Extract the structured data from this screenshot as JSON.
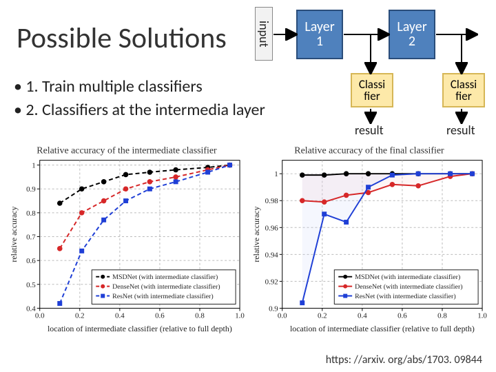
{
  "title": "Possible Solutions",
  "bullets": [
    "• 1. Train multiple classifiers",
    "• 2. Classifiers at the intermedia layer"
  ],
  "net": {
    "input": "input",
    "layer1": "Layer\n1",
    "layer2": "Layer\n2",
    "classi": "Classi\nfier",
    "result": "result"
  },
  "cite": "https: //arxiv. org/abs/1703. 09844",
  "chart_data": [
    {
      "type": "line",
      "title": "Relative accuracy of the intermediate classifier",
      "xlabel": "location of intermediate classifier (relative to full depth)",
      "ylabel": "relative accuracy",
      "xlim": [
        0.0,
        1.0
      ],
      "ylim": [
        0.4,
        1.02
      ],
      "xticks": [
        0.0,
        0.2,
        0.4,
        0.6,
        0.8,
        1.0
      ],
      "yticks": [
        0.4,
        0.5,
        0.6,
        0.7,
        0.8,
        0.9,
        1.0
      ],
      "grid": true,
      "styles": {
        "MSDNet (with intermediate classifier)": {
          "color": "#000000",
          "dashed": true,
          "marker": "circle"
        },
        "DenseNet (with intermediate classifier)": {
          "color": "#d62728",
          "dashed": true,
          "marker": "circle"
        },
        "ResNet (with intermediate classifier)": {
          "color": "#1f3fd6",
          "dashed": true,
          "marker": "square"
        }
      },
      "series": [
        {
          "name": "MSDNet (with intermediate classifier)",
          "x": [
            0.1,
            0.21,
            0.32,
            0.43,
            0.55,
            0.68,
            0.84,
            0.95
          ],
          "y": [
            0.84,
            0.9,
            0.93,
            0.96,
            0.97,
            0.98,
            0.99,
            1.0
          ]
        },
        {
          "name": "DenseNet (with intermediate classifier)",
          "x": [
            0.1,
            0.21,
            0.32,
            0.43,
            0.55,
            0.68,
            0.84,
            0.95
          ],
          "y": [
            0.65,
            0.8,
            0.85,
            0.9,
            0.93,
            0.95,
            0.98,
            1.0
          ]
        },
        {
          "name": "ResNet (with intermediate classifier)",
          "x": [
            0.1,
            0.21,
            0.32,
            0.43,
            0.55,
            0.68,
            0.84,
            0.95
          ],
          "y": [
            0.42,
            0.64,
            0.77,
            0.85,
            0.9,
            0.93,
            0.97,
            1.0
          ]
        }
      ],
      "legend_pos": "lower-right"
    },
    {
      "type": "line",
      "title": "Relative accuracy of the final classifier",
      "xlabel": "location of intermediate classifier (relative to full depth)",
      "ylabel": "relative accuracy",
      "xlim": [
        0.0,
        1.0
      ],
      "ylim": [
        0.9,
        1.01
      ],
      "xticks": [
        0.0,
        0.2,
        0.4,
        0.6,
        0.8,
        1.0
      ],
      "yticks": [
        0.9,
        0.92,
        0.94,
        0.96,
        0.98,
        1.0
      ],
      "grid": true,
      "fill": true,
      "styles": {
        "MSDNet (with intermediate classifier)": {
          "color": "#000000",
          "dashed": false,
          "marker": "circle",
          "fill": "#cccccc"
        },
        "DenseNet (with intermediate classifier)": {
          "color": "#d62728",
          "dashed": false,
          "marker": "circle",
          "fill": "#f7c7c7"
        },
        "ResNet (with intermediate classifier)": {
          "color": "#1f3fd6",
          "dashed": false,
          "marker": "square",
          "fill": "#c7d0f7"
        }
      },
      "series": [
        {
          "name": "MSDNet (with intermediate classifier)",
          "x": [
            0.1,
            0.21,
            0.32,
            0.43,
            0.55,
            0.68,
            0.84,
            0.95
          ],
          "y": [
            0.999,
            0.999,
            1.0,
            1.0,
            1.0,
            1.0,
            1.0,
            1.0
          ]
        },
        {
          "name": "DenseNet (with intermediate classifier)",
          "x": [
            0.1,
            0.21,
            0.32,
            0.43,
            0.55,
            0.68,
            0.84,
            0.95
          ],
          "y": [
            0.98,
            0.979,
            0.984,
            0.986,
            0.992,
            0.991,
            0.998,
            1.0
          ]
        },
        {
          "name": "ResNet (with intermediate classifier)",
          "x": [
            0.1,
            0.21,
            0.32,
            0.43,
            0.55,
            0.68,
            0.84,
            0.95
          ],
          "y": [
            0.904,
            0.97,
            0.964,
            0.99,
            0.999,
            1.0,
            1.0,
            1.0
          ]
        }
      ],
      "legend_pos": "lower-right"
    }
  ]
}
